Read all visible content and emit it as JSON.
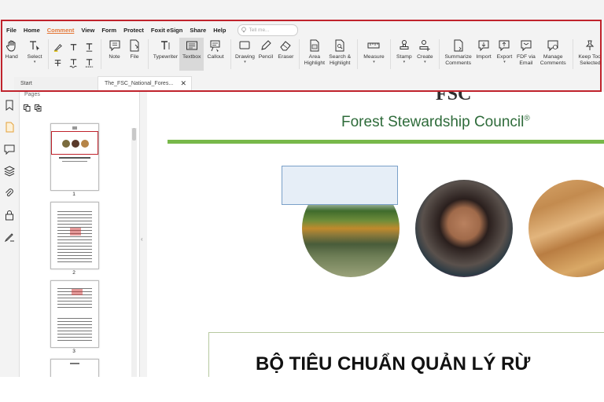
{
  "menu": {
    "items": [
      "File",
      "Home",
      "Comment",
      "View",
      "Form",
      "Protect",
      "Foxit eSign",
      "Share",
      "Help"
    ],
    "active": "Comment",
    "search_placeholder": "Tell me..."
  },
  "ribbon": {
    "hand": "Hand",
    "select": "Select",
    "note": "Note",
    "file": "File",
    "typewriter": "Typewriter",
    "textbox": "Textbox",
    "callout": "Callout",
    "drawing": "Drawing",
    "pencil": "Pencil",
    "eraser": "Eraser",
    "area_highlight": [
      "Area",
      "Highlight"
    ],
    "search_highlight": [
      "Search &",
      "Highlight"
    ],
    "measure": "Measure",
    "stamp": "Stamp",
    "create": "Create",
    "summarize": [
      "Summarize",
      "Comments"
    ],
    "import": "Import",
    "export": "Export",
    "fdf_email": [
      "FDF via",
      "Email"
    ],
    "manage": [
      "Manage",
      "Comments"
    ],
    "keep_tool": [
      "Keep Tool",
      "Selected"
    ]
  },
  "tabs": {
    "start": "Start",
    "file": "The_FSC_National_Fores..."
  },
  "pages_panel": {
    "label": "Pages",
    "thumbnails": [
      "1",
      "2",
      "3"
    ]
  },
  "document": {
    "logo": "FSC",
    "title": "Forest Stewardship Council",
    "title_mark": "®",
    "heading": "BỘ TIÊU CHUẨN QUẢN LÝ RỪ"
  },
  "colors": {
    "accent_tab": "#e4793a",
    "highlight_box": "#c0232c",
    "fsc_green": "#2e6b3a",
    "rule_green": "#78b84a"
  }
}
